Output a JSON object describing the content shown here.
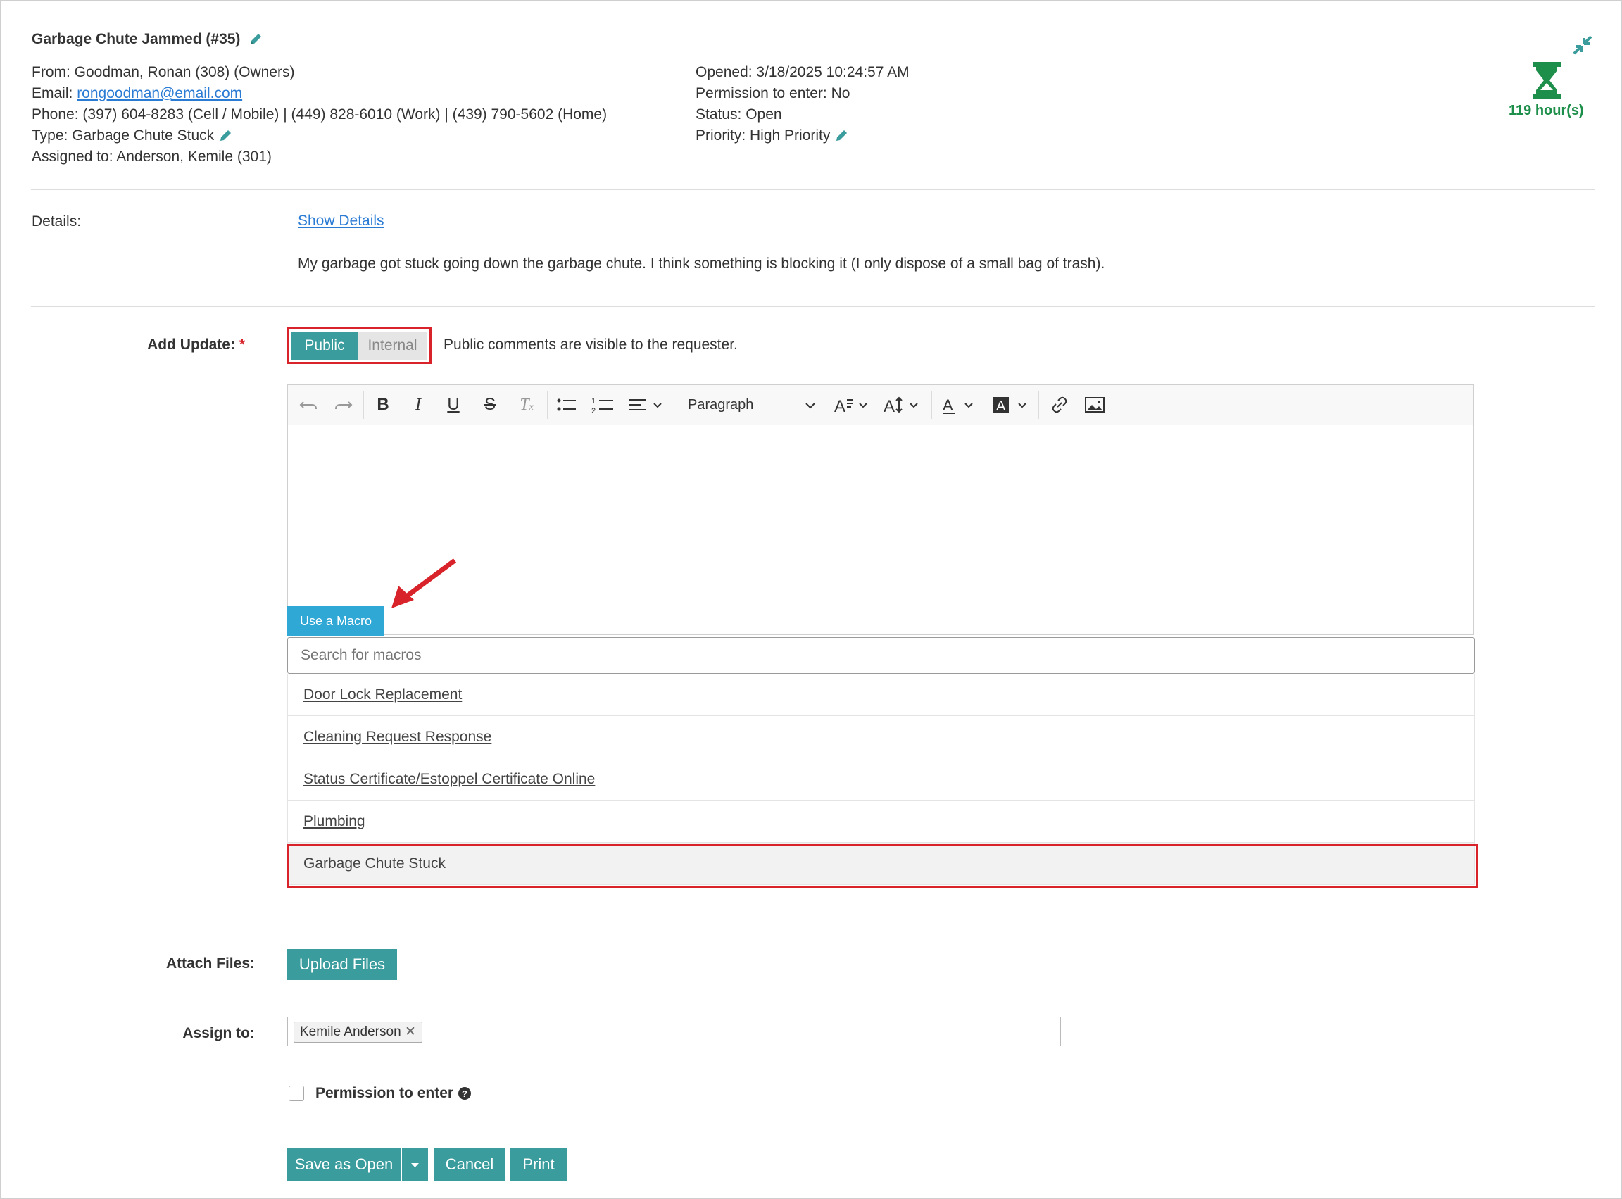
{
  "ticket": {
    "title": "Garbage Chute Jammed (#35)",
    "from": "From: Goodman, Ronan (308) (Owners)",
    "email_label": "Email: ",
    "email": "rongoodman@email.com",
    "phone": "Phone: (397) 604-8283 (Cell / Mobile) | (449) 828-6010 (Work) | (439) 790-5602 (Home)",
    "type": "Type: Garbage Chute Stuck",
    "assigned": "Assigned to: Anderson, Kemile (301)",
    "opened": "Opened: 3/18/2025 10:24:57 AM",
    "permission": "Permission to enter: No",
    "status": "Status: Open",
    "priority": "Priority: High Priority",
    "timer": "119 hour(s)"
  },
  "details": {
    "label": "Details:",
    "show_link": "Show Details",
    "text": "My garbage got stuck going down the garbage chute. I think something is blocking it (I only dispose of a small bag of trash)."
  },
  "update": {
    "label": "Add Update:",
    "required": "*",
    "public": "Public",
    "internal": "Internal",
    "hint": "Public comments are visible to the requester."
  },
  "toolbar": {
    "paragraph": "Paragraph"
  },
  "macro": {
    "button": "Use a Macro",
    "search_placeholder": "Search for macros",
    "items": [
      "Door Lock Replacement",
      "Cleaning Request Response",
      "Status Certificate/Estoppel Certificate Online",
      "Plumbing",
      "Garbage Chute Stuck"
    ]
  },
  "attach": {
    "label": "Attach Files:",
    "button": "Upload Files"
  },
  "assign": {
    "label": "Assign to:",
    "chip": "Kemile Anderson"
  },
  "perm": {
    "label": "Permission to enter"
  },
  "actions": {
    "save": "Save as Open",
    "cancel": "Cancel",
    "print": "Print"
  },
  "colors": {
    "teal": "#3a9c9c",
    "highlight": "#d8232a",
    "macro": "#2fa8d6",
    "timer": "#1e8f4a"
  }
}
